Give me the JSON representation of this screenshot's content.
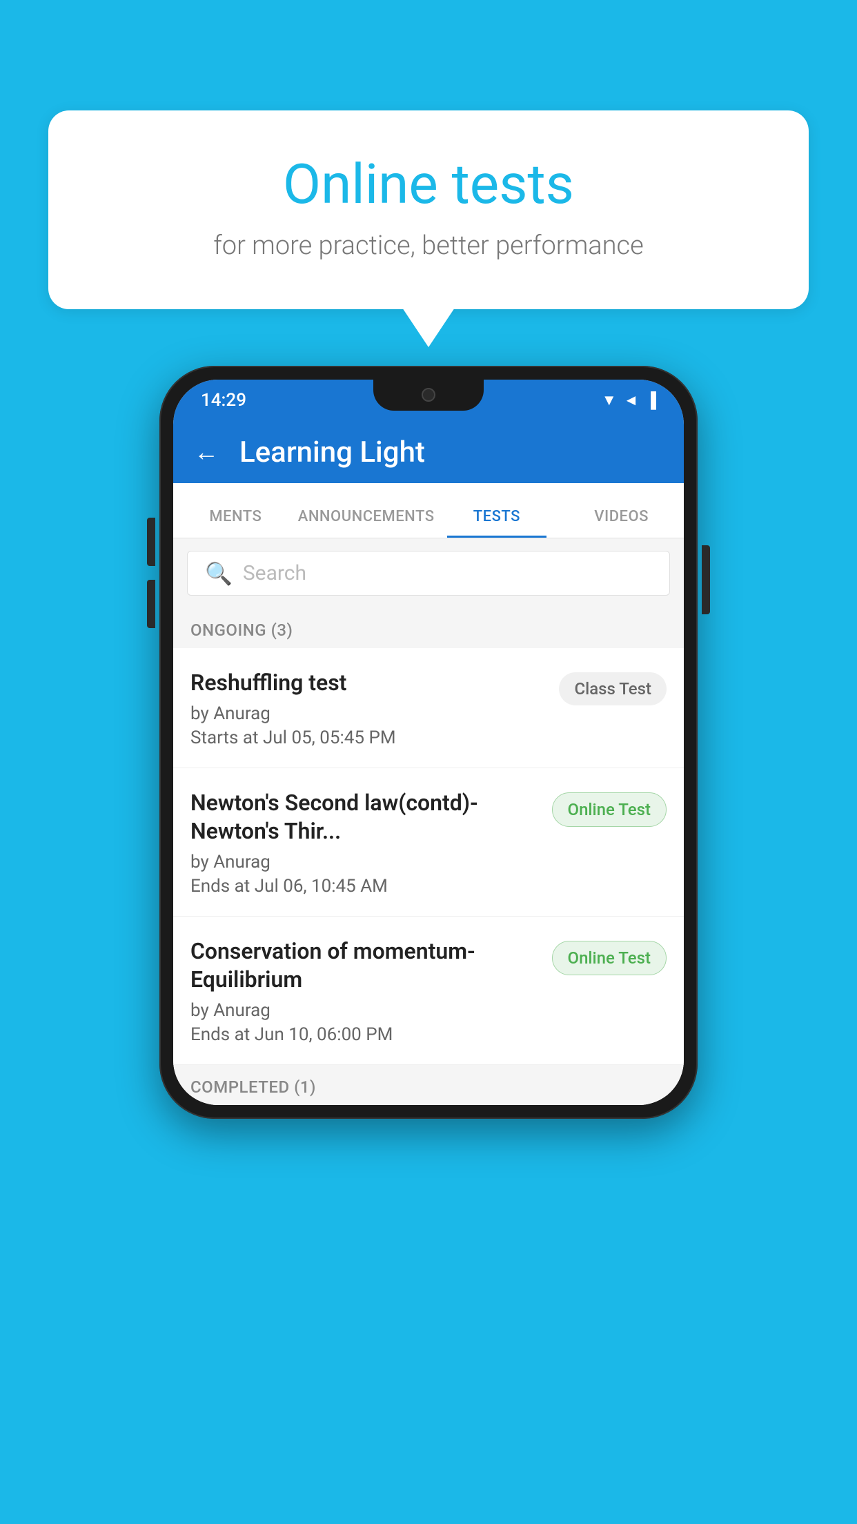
{
  "background_color": "#1bb8e8",
  "bubble": {
    "title": "Online tests",
    "subtitle": "for more practice, better performance"
  },
  "phone": {
    "status_bar": {
      "time": "14:29",
      "icons": "▼◄▐"
    },
    "header": {
      "back_label": "←",
      "title": "Learning Light"
    },
    "tabs": [
      {
        "label": "MENTS",
        "active": false
      },
      {
        "label": "ANNOUNCEMENTS",
        "active": false
      },
      {
        "label": "TESTS",
        "active": true
      },
      {
        "label": "VIDEOS",
        "active": false
      }
    ],
    "search": {
      "placeholder": "Search"
    },
    "ongoing_label": "ONGOING (3)",
    "tests": [
      {
        "name": "Reshuffling test",
        "author": "by Anurag",
        "date": "Starts at  Jul 05, 05:45 PM",
        "badge": "Class Test",
        "badge_type": "class"
      },
      {
        "name": "Newton's Second law(contd)-Newton's Thir...",
        "author": "by Anurag",
        "date": "Ends at  Jul 06, 10:45 AM",
        "badge": "Online Test",
        "badge_type": "online"
      },
      {
        "name": "Conservation of momentum-Equilibrium",
        "author": "by Anurag",
        "date": "Ends at  Jun 10, 06:00 PM",
        "badge": "Online Test",
        "badge_type": "online"
      }
    ],
    "completed_label": "COMPLETED (1)"
  }
}
